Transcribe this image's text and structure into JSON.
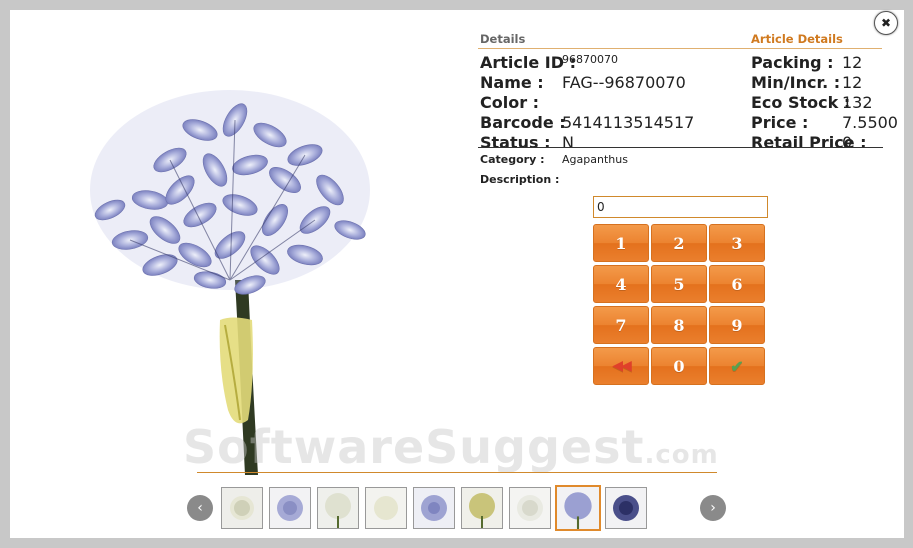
{
  "details": {
    "section_title": "Details",
    "article_section_title": "Article Details",
    "left_fields": [
      {
        "label": "Article ID :",
        "value": "96870070"
      },
      {
        "label": "Name :",
        "value": "FAG--96870070"
      },
      {
        "label": "Color :",
        "value": ""
      },
      {
        "label": "Barcode :",
        "value": "5414113514517"
      },
      {
        "label": "Status :",
        "value": "N"
      }
    ],
    "right_fields": [
      {
        "label": "Packing :",
        "value": "12"
      },
      {
        "label": "Min/Incr. :",
        "value": "12"
      },
      {
        "label": "Eco Stock :",
        "value": "132"
      },
      {
        "label": "Price :",
        "value": "7.5500"
      },
      {
        "label": "Retail Price :",
        "value": "0"
      }
    ],
    "category_label": "Category :",
    "category_value": "Agapanthus",
    "description_label": "Description :",
    "description_value": ""
  },
  "keypad": {
    "input_value": "0",
    "keys": [
      "1",
      "2",
      "3",
      "4",
      "5",
      "6",
      "7",
      "8",
      "9",
      "0"
    ],
    "backspace_icon": "double-left-arrow-icon",
    "confirm_icon": "check-icon",
    "accent_color": "#ec8330"
  },
  "close_icon": "close-icon",
  "thumbnails": {
    "count": 9,
    "selected_index": 7,
    "prev_icon": "chevron-left-icon",
    "next_icon": "chevron-right-icon"
  },
  "watermark": {
    "main": "SoftwareSuggest",
    "suffix": ".com"
  }
}
